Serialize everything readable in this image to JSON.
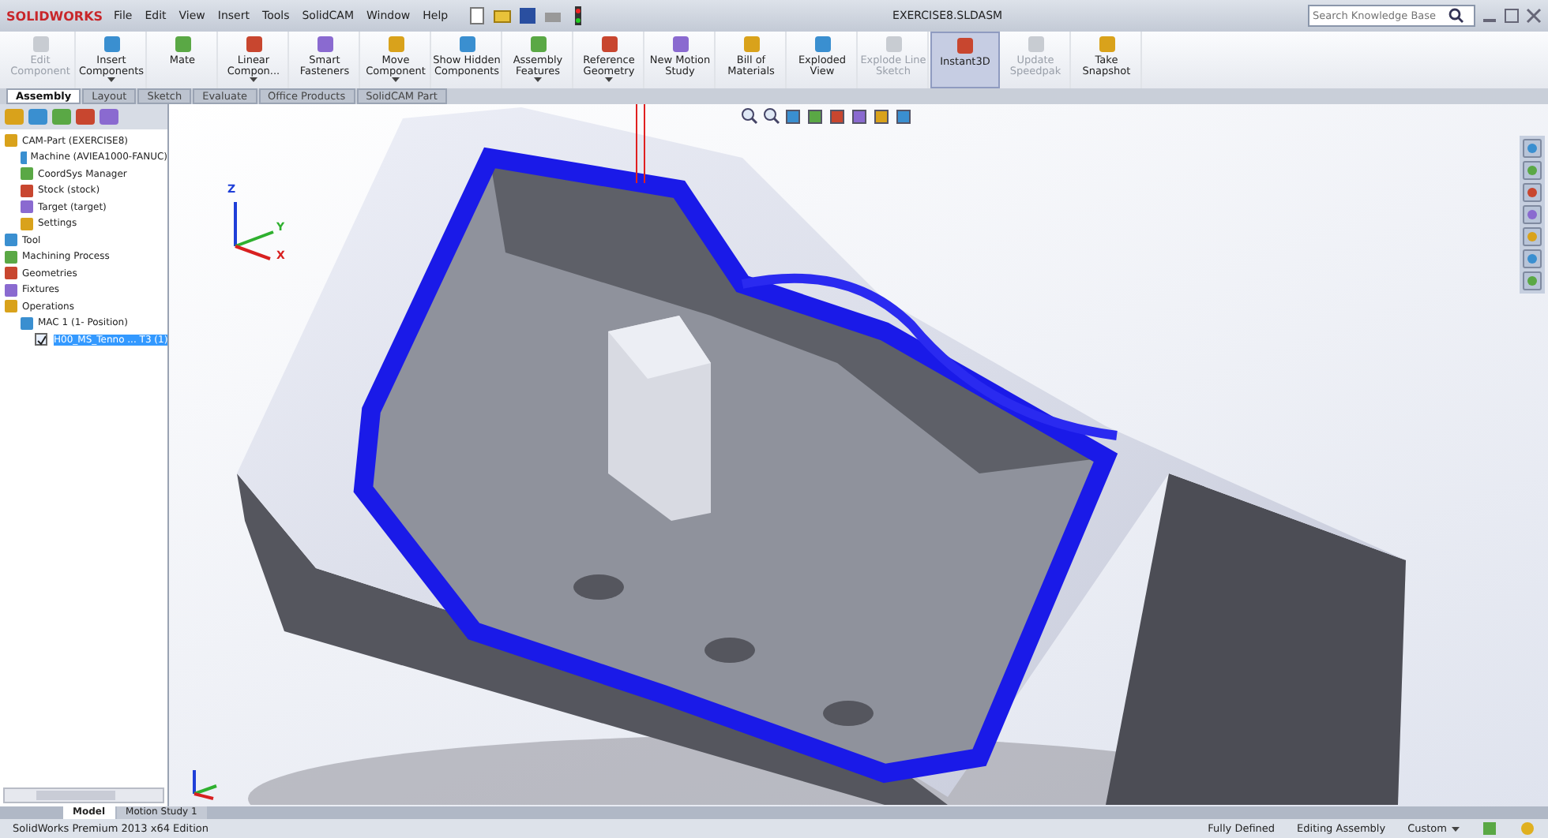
{
  "app": {
    "logo": "SOLIDWORKS"
  },
  "menu": [
    "File",
    "Edit",
    "View",
    "Insert",
    "Tools",
    "SolidCAM",
    "Window",
    "Help"
  ],
  "window": {
    "title": "EXERCISE8.SLDASM"
  },
  "search": {
    "placeholder": "Search Knowledge Base"
  },
  "ribbon": [
    {
      "label": "Edit Component",
      "disabled": true,
      "selected": false,
      "dropdown": false
    },
    {
      "label": "Insert Components",
      "disabled": false,
      "selected": false,
      "dropdown": true
    },
    {
      "label": "Mate",
      "disabled": false,
      "selected": false,
      "dropdown": false
    },
    {
      "label": "Linear Compon...",
      "disabled": false,
      "selected": false,
      "dropdown": true
    },
    {
      "label": "Smart Fasteners",
      "disabled": false,
      "selected": false,
      "dropdown": false
    },
    {
      "label": "Move Component",
      "disabled": false,
      "selected": false,
      "dropdown": true
    },
    {
      "label": "Show Hidden Components",
      "disabled": false,
      "selected": false,
      "dropdown": false
    },
    {
      "label": "Assembly Features",
      "disabled": false,
      "selected": false,
      "dropdown": true
    },
    {
      "label": "Reference Geometry",
      "disabled": false,
      "selected": false,
      "dropdown": true
    },
    {
      "label": "New Motion Study",
      "disabled": false,
      "selected": false,
      "dropdown": false
    },
    {
      "label": "Bill of Materials",
      "disabled": false,
      "selected": false,
      "dropdown": false
    },
    {
      "label": "Exploded View",
      "disabled": false,
      "selected": false,
      "dropdown": false
    },
    {
      "label": "Explode Line Sketch",
      "disabled": true,
      "selected": false,
      "dropdown": false
    },
    {
      "label": "Instant3D",
      "disabled": false,
      "selected": true,
      "dropdown": false
    },
    {
      "label": "Update Speedpak",
      "disabled": true,
      "selected": false,
      "dropdown": false
    },
    {
      "label": "Take Snapshot",
      "disabled": false,
      "selected": false,
      "dropdown": false
    }
  ],
  "tabs": [
    {
      "label": "Assembly",
      "selected": true
    },
    {
      "label": "Layout",
      "selected": false
    },
    {
      "label": "Sketch",
      "selected": false
    },
    {
      "label": "Evaluate",
      "selected": false
    },
    {
      "label": "Office Products",
      "selected": false
    },
    {
      "label": "SolidCAM Part",
      "selected": false
    }
  ],
  "tree": [
    {
      "label": "CAM-Part (EXERCISE8)",
      "selected": false,
      "children": [
        {
          "label": "Machine (AVIEA1000-FANUC)",
          "selected": false
        },
        {
          "label": "CoordSys Manager",
          "selected": false
        },
        {
          "label": "Stock (stock)",
          "selected": false
        },
        {
          "label": "Target (target)",
          "selected": false
        },
        {
          "label": "Settings",
          "selected": false
        }
      ]
    },
    {
      "label": "Tool",
      "selected": false
    },
    {
      "label": "Machining Process",
      "selected": false
    },
    {
      "label": "Geometries",
      "selected": false
    },
    {
      "label": "Fixtures",
      "selected": false
    },
    {
      "label": "Operations",
      "selected": false,
      "children": [
        {
          "label": "MAC 1 (1- Position)",
          "selected": false,
          "children": [
            {
              "label": "H00_MS_Tenno ... T3 (1)",
              "selected": true,
              "checked": true
            }
          ]
        }
      ]
    }
  ],
  "triad": {
    "axes": [
      "Z",
      "Y",
      "X"
    ]
  },
  "bottom_tabs": [
    {
      "label": "Model",
      "selected": true
    },
    {
      "label": "Motion Study 1",
      "selected": false
    }
  ],
  "status_bar": {
    "edition": "SolidWorks Premium 2013 x64 Edition",
    "state": "Fully Defined",
    "mode": "Editing Assembly",
    "units": "Custom"
  }
}
